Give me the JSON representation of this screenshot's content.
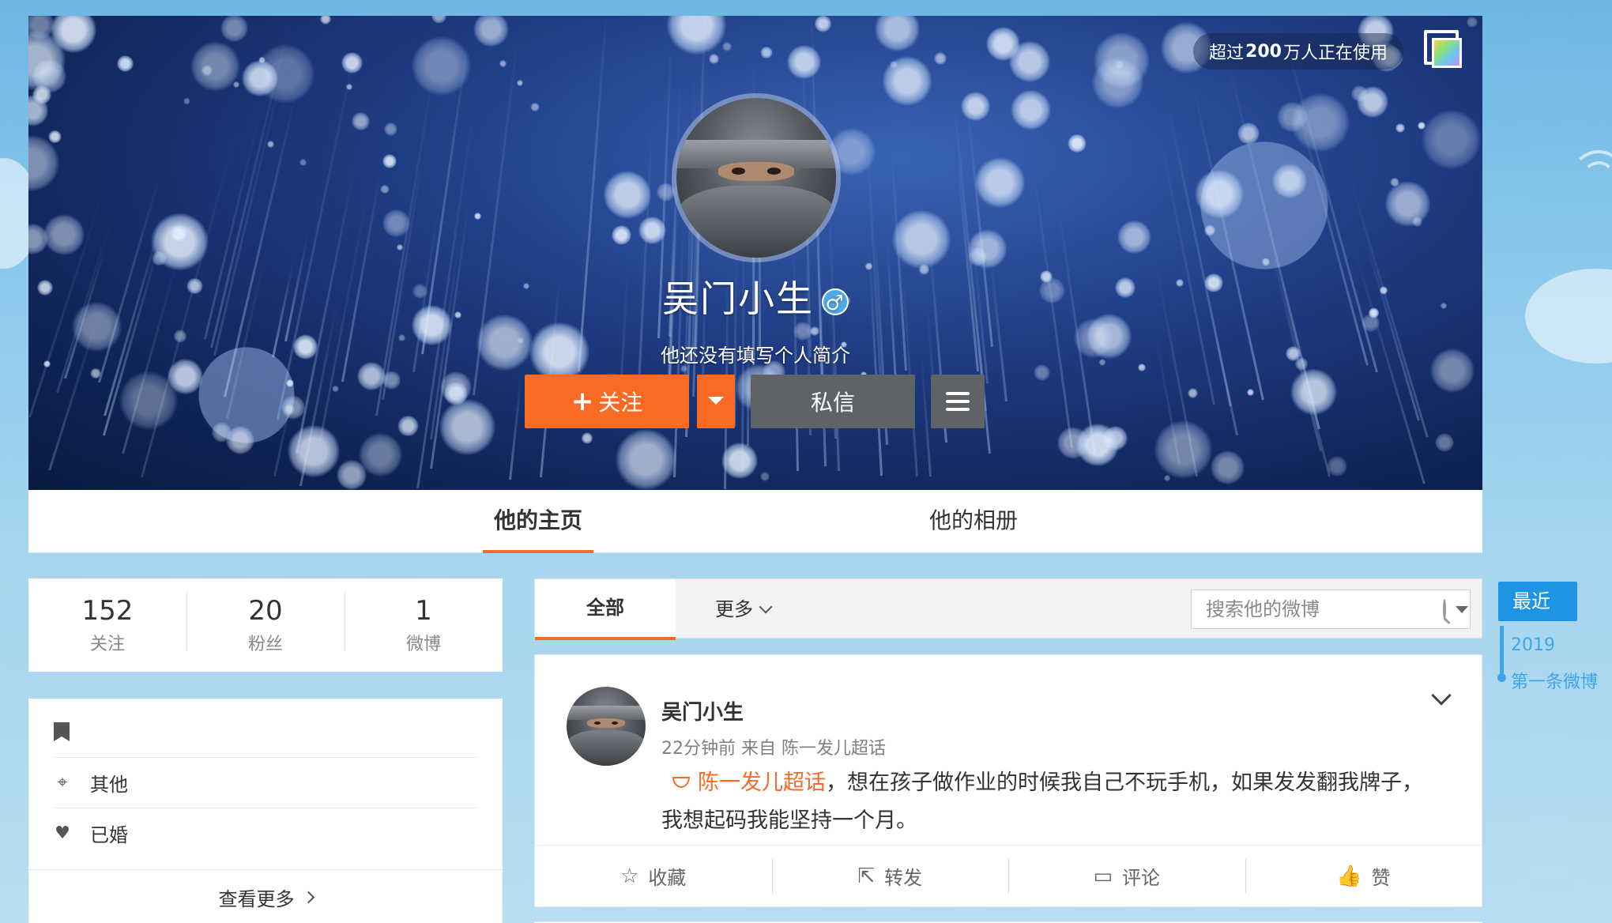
{
  "header": {
    "usage_prefix": "超过",
    "usage_count": "200",
    "usage_suffix": "万人正在使用",
    "profile_name": "吴门小生",
    "gender_symbol": "♂",
    "bio": "他还没有填写个人简介",
    "follow_label": "关注",
    "follow_plus": "+",
    "message_label": "私信"
  },
  "tabs": [
    {
      "label": "他的主页",
      "active": true
    },
    {
      "label": "他的相册",
      "active": false
    }
  ],
  "stats": [
    {
      "value": "152",
      "label": "关注"
    },
    {
      "value": "20",
      "label": "粉丝"
    },
    {
      "value": "1",
      "label": "微博"
    }
  ],
  "info": {
    "location": "其他",
    "relationship": "已婚",
    "see_more": "查看更多"
  },
  "filter": {
    "all_label": "全部",
    "more_label": "更多",
    "search_placeholder": "搜索他的微博"
  },
  "post": {
    "author": "吴门小生",
    "meta": "22分钟前 来自 陈一发儿超话",
    "topic": "陈一发儿超话",
    "text": "，想在孩子做作业的时候我自己不玩手机，如果发发翻我牌子，我想起码我能坚持一个月。",
    "actions": [
      {
        "icon": "☆",
        "label": "收藏"
      },
      {
        "icon": "⇱",
        "label": "转发"
      },
      {
        "icon": "▭",
        "label": "评论"
      },
      {
        "icon": "👍",
        "label": "赞"
      }
    ]
  },
  "timeline": {
    "recent": "最近",
    "year": "2019",
    "first_post": "第一条微博"
  },
  "colors": {
    "accent_orange": "#f96a24",
    "timeline_blue": "#1e95e4",
    "button_gray": "#5f6366"
  }
}
